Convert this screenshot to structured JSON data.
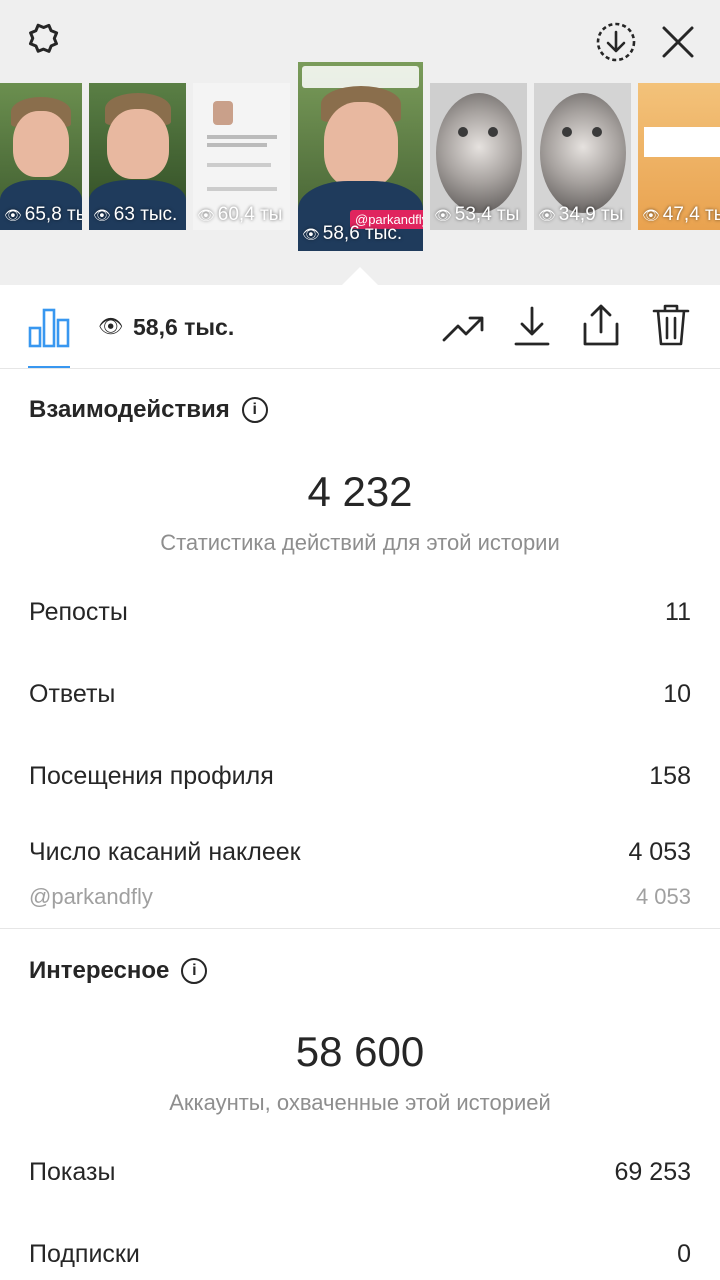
{
  "top_bar": {
    "settings_icon": "gear-icon",
    "download_icon": "download-circle-icon",
    "close_icon": "close-icon"
  },
  "stories": [
    {
      "views": "65,8 ты"
    },
    {
      "views": "63 тыс."
    },
    {
      "views": "60,4 ты"
    },
    {
      "views": "58,6 тыс.",
      "sticker": "@parkandfly",
      "selected": true
    },
    {
      "views": "53,4 ты"
    },
    {
      "views": "34,9 ты"
    },
    {
      "views": "47,4 ты"
    }
  ],
  "toolbar": {
    "views": "58,6 тыс.",
    "icons": [
      "bar-chart-icon",
      "eye-icon",
      "trend-icon",
      "download-icon",
      "share-icon",
      "trash-icon"
    ]
  },
  "interactions": {
    "title": "Взаимодействия",
    "total": "4 232",
    "subtitle": "Статистика действий для этой истории",
    "rows": [
      {
        "label": "Репосты",
        "value": "11"
      },
      {
        "label": "Ответы",
        "value": "10"
      },
      {
        "label": "Посещения профиля",
        "value": "158"
      },
      {
        "label": "Число касаний наклеек",
        "value": "4 053"
      }
    ],
    "sub_row": {
      "label": "@parkandfly",
      "value": "4 053"
    }
  },
  "discovery": {
    "title": "Интересное",
    "total": "58 600",
    "subtitle": "Аккаунты, охваченные этой историей",
    "rows": [
      {
        "label": "Показы",
        "value": "69 253"
      },
      {
        "label": "Подписки",
        "value": "0"
      }
    ]
  },
  "colors": {
    "accent": "#3897f0",
    "text": "#262626",
    "muted": "#8e8e8e"
  }
}
